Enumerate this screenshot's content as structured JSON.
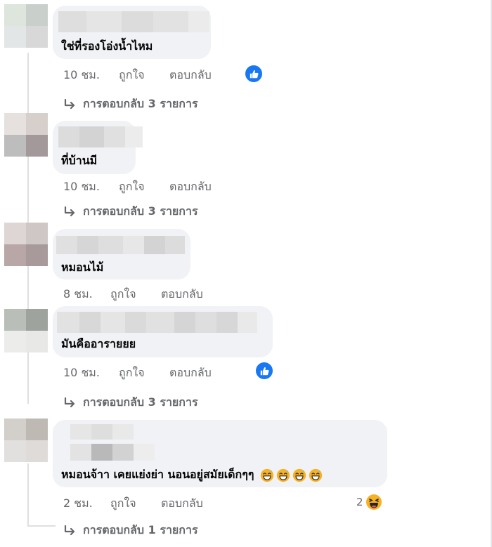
{
  "comments": [
    {
      "text": "ใช่ที่รองโอ่งน้ำไหม",
      "time": "10 ชม.",
      "like_label": "ถูกใจ",
      "reply_label": "ตอบกลับ",
      "reaction_icon": "like-icon",
      "replies_text": "การตอบกลับ 3 รายการ"
    },
    {
      "text": "ที่บ้านมี",
      "time": "10 ชม.",
      "like_label": "ถูกใจ",
      "reply_label": "ตอบกลับ",
      "replies_text": "การตอบกลับ 3 รายการ"
    },
    {
      "text": "หมอนไม้",
      "time": "8 ชม.",
      "like_label": "ถูกใจ",
      "reply_label": "ตอบกลับ"
    },
    {
      "text": "มันคืออารายยย",
      "time": "10 ชม.",
      "like_label": "ถูกใจ",
      "reply_label": "ตอบกลับ",
      "reaction_icon": "like-icon",
      "replies_text": "การตอบกลับ 3 รายการ"
    },
    {
      "text": "หมอนจ้าา เคยแย่งย่า นอนอยู่สมัยเด็กๆๆ",
      "emojis": [
        "grinning-sweat-icon",
        "grinning-sweat-icon",
        "grinning-sweat-icon",
        "grinning-sweat-icon"
      ],
      "time": "2 ชม.",
      "like_label": "ถูกใจ",
      "reply_label": "ตอบกลับ",
      "reaction_count": "2",
      "reaction_icon": "haha-icon",
      "replies_text": "การตอบกลับ 1 รายการ"
    }
  ],
  "colors": {
    "bubble": "#f0f2f5",
    "meta_text": "#65676b",
    "like_blue": "#1877f2",
    "emoji_yellow": "#f7b125"
  }
}
